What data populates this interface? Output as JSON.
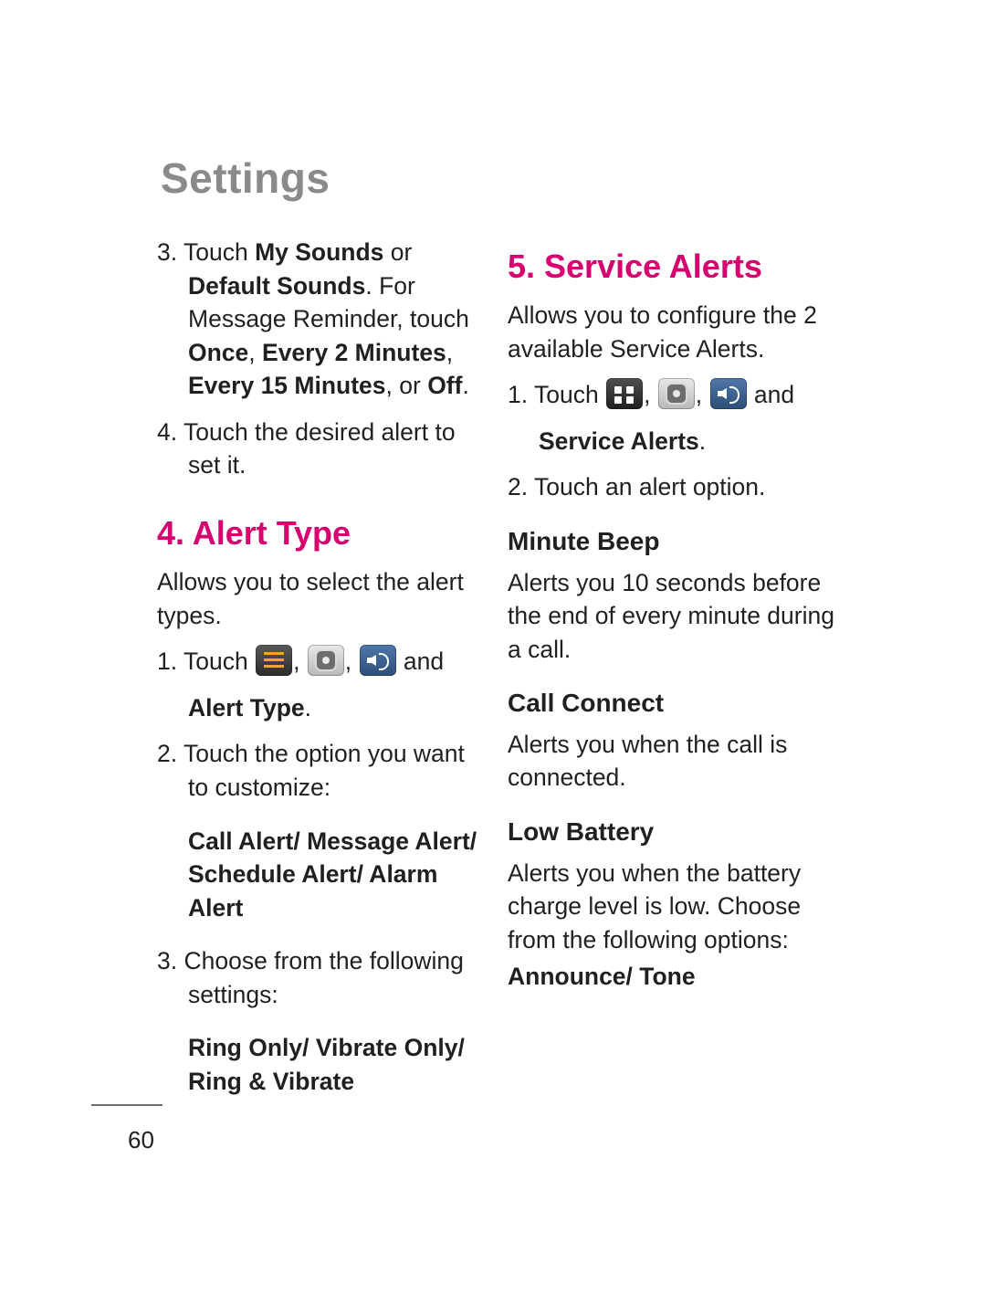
{
  "document": {
    "chapter_title": "Settings",
    "page_number": "60"
  },
  "left_column": {
    "step3_pre": "3. Touch ",
    "step3_b1": "My Sounds",
    "step3_mid1": " or ",
    "step3_b2": "Default Sounds",
    "step3_mid2": ". For Message Reminder, touch ",
    "step3_b3": "Once",
    "step3_mid3": ", ",
    "step3_b4": "Every 2 Minutes",
    "step3_mid4": ", ",
    "step3_b5": "Every 15 Minutes",
    "step3_mid5": ", or ",
    "step3_b6": "Off",
    "step3_end": ".",
    "step4": "4. Touch the desired alert to set it.",
    "section_alert_type": "4. Alert Type",
    "alert_type_intro": "Allows you to select the alert types.",
    "touch_label": "1. Touch ",
    "touch_comma": ", ",
    "touch_and": " and",
    "touch_target": "Alert Type",
    "touch_period": ".",
    "step2": "2. Touch the option you want to customize:",
    "options_line1": "Call Alert/ Message Alert/",
    "options_line2": "Schedule Alert/ Alarm Alert",
    "step3b": "3. Choose from the following settings:",
    "settings_line1": "Ring Only/ Vibrate Only/",
    "settings_line2": "Ring & Vibrate",
    "icons": [
      "list-icon",
      "gear-icon",
      "speaker-icon"
    ]
  },
  "right_column": {
    "section_service_alerts": "5. Service Alerts",
    "intro": "Allows you to configure the 2 available Service Alerts.",
    "touch_label": "1. Touch ",
    "touch_comma": ", ",
    "touch_and": " and",
    "touch_target": "Service Alerts",
    "touch_period": ".",
    "step2": "2. Touch an alert option.",
    "minute_beep_head": "Minute Beep",
    "minute_beep_body": "Alerts you 10 seconds before the end of every minute during a call.",
    "call_connect_head": "Call Connect",
    "call_connect_body": "Alerts you when the call is connected.",
    "low_battery_head": "Low Battery",
    "low_battery_body": "Alerts you when the battery charge level is low. Choose from the following options:",
    "low_battery_options": "Announce/ Tone",
    "icons": [
      "grid-icon",
      "gear-icon",
      "speaker-icon"
    ]
  },
  "colors": {
    "accent": "#d6006e",
    "chapter_gray": "#8a8a8a",
    "body": "#231f20"
  }
}
